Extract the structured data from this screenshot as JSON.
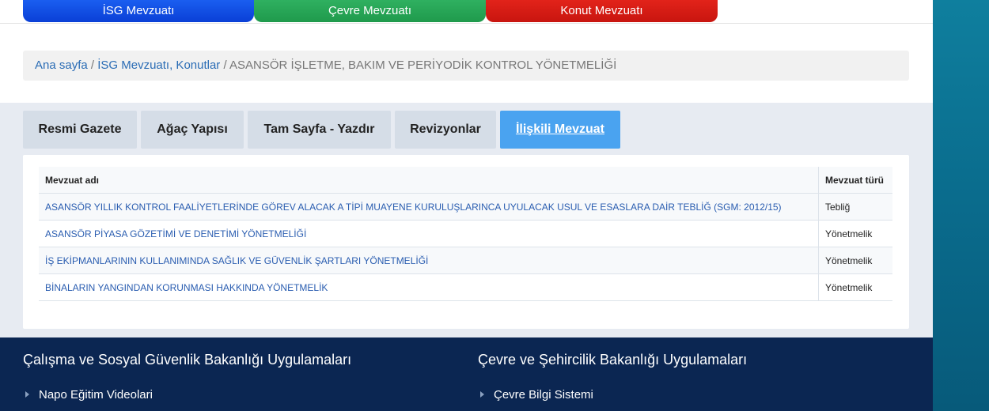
{
  "category_tabs": [
    {
      "label": "İSG Mevzuatı",
      "color": "#0a4fe6"
    },
    {
      "label": "Çevre Mevzuatı",
      "color": "#26a556"
    },
    {
      "label": "Konut Mevzuatı",
      "color": "#d61c14"
    }
  ],
  "breadcrumb": {
    "home": "Ana sayfa",
    "sep1": " / ",
    "section": "İSG Mevzuatı, Konutlar",
    "sep2": " / ",
    "current": "ASANSÖR İŞLETME, BAKIM VE PERİYODİK KONTROL YÖNETMELİĞİ"
  },
  "tabs": [
    {
      "label": "Resmi Gazete",
      "active": false
    },
    {
      "label": "Ağaç Yapısı",
      "active": false
    },
    {
      "label": "Tam Sayfa - Yazdır",
      "active": false
    },
    {
      "label": "Revizyonlar",
      "active": false
    },
    {
      "label": "İlişkili Mevzuat",
      "active": true
    }
  ],
  "table": {
    "headers": {
      "name": "Mevzuat adı",
      "type": "Mevzuat türü"
    },
    "rows": [
      {
        "name": "ASANSÖR YILLIK KONTROL FAALİYETLERİNDE GÖREV ALACAK A TİPİ MUAYENE KURULUŞLARINCA UYULACAK USUL VE ESASLARA DAİR TEBLİĞ (SGM: 2012/15)",
        "type": "Tebliğ"
      },
      {
        "name": "ASANSÖR PİYASA GÖZETİMİ VE DENETİMİ YÖNETMELİĞİ",
        "type": "Yönetmelik"
      },
      {
        "name": "İŞ EKİPMANLARININ KULLANIMINDA SAĞLIK VE GÜVENLİK ŞARTLARI YÖNETMELİĞİ",
        "type": "Yönetmelik"
      },
      {
        "name": "BİNALARIN YANGINDAN KORUNMASI HAKKINDA YÖNETMELİK",
        "type": "Yönetmelik"
      }
    ]
  },
  "footer": {
    "left": {
      "heading": "Çalışma ve Sosyal Güvenlik Bakanlığı Uygulamaları",
      "link": "Napo Eğitim Videolari"
    },
    "right": {
      "heading": "Çevre ve Şehircilik Bakanlığı Uygulamaları",
      "link": "Çevre Bilgi Sistemi"
    }
  },
  "colors": {
    "accent_tab": "#4aa3f0",
    "footer_bg": "#0b2652",
    "link": "#2a5db0"
  }
}
